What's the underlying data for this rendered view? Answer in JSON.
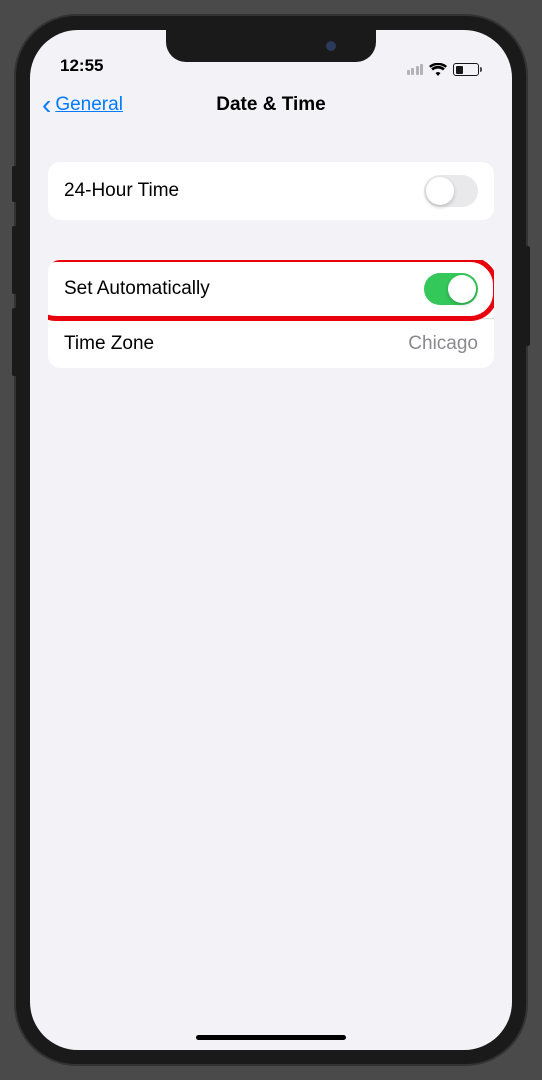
{
  "status": {
    "time": "12:55"
  },
  "nav": {
    "back_label": "General",
    "title": "Date & Time"
  },
  "groups": {
    "group1": {
      "row0": {
        "label": "24-Hour Time",
        "toggle": false
      }
    },
    "group2": {
      "row0": {
        "label": "Set Automatically",
        "toggle": true,
        "highlighted": true
      },
      "row1": {
        "label": "Time Zone",
        "value": "Chicago"
      }
    }
  }
}
